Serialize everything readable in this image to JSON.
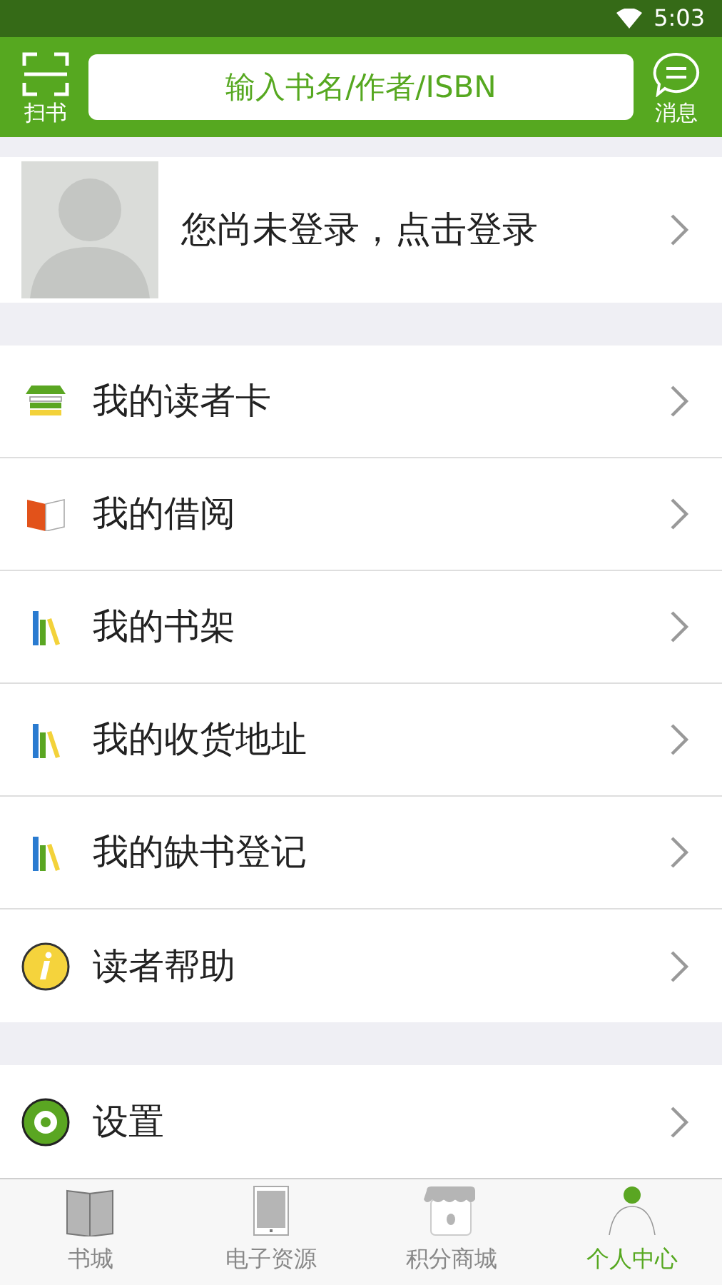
{
  "status_bar": {
    "time": "5:03"
  },
  "header": {
    "scan_label": "扫书",
    "search": {
      "placeholder": "输入书名/作者/ISBN"
    },
    "message_label": "消息"
  },
  "profile": {
    "text": "您尚未登录，点击登录"
  },
  "menu_groups": [
    {
      "items": [
        {
          "kind": "card",
          "label": "我的读者卡"
        },
        {
          "kind": "borrow",
          "label": "我的借阅"
        },
        {
          "kind": "shelf",
          "label": "我的书架"
        },
        {
          "kind": "shelf",
          "label": "我的收货地址"
        },
        {
          "kind": "shelf",
          "label": "我的缺书登记"
        },
        {
          "kind": "help",
          "label": "读者帮助"
        }
      ]
    },
    {
      "items": [
        {
          "kind": "settings",
          "label": "设置"
        }
      ]
    }
  ],
  "tab_bar": [
    {
      "kind": "book",
      "label": "书城",
      "selected": false
    },
    {
      "kind": "tablet",
      "label": "电子资源",
      "selected": false
    },
    {
      "kind": "shop",
      "label": "积分商城",
      "selected": false
    },
    {
      "kind": "person",
      "label": "个人中心",
      "selected": true
    }
  ]
}
